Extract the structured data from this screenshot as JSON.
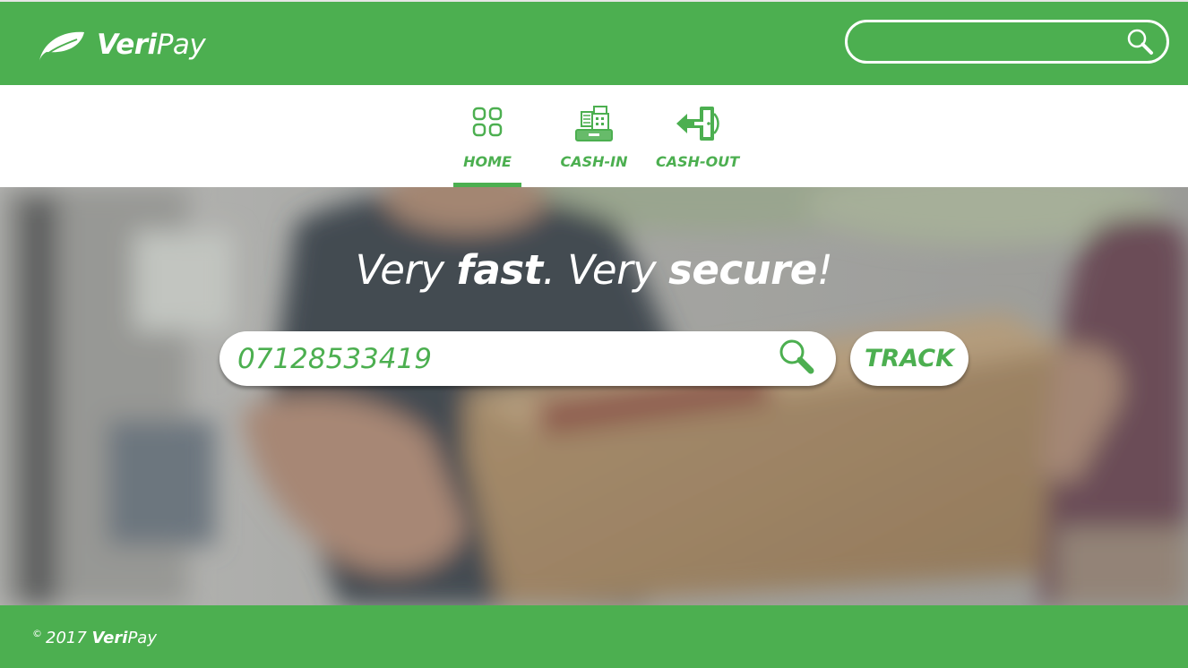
{
  "colors": {
    "brand_green": "#4caf50",
    "white": "#ffffff"
  },
  "header": {
    "brand_bold": "Veri",
    "brand_light": "Pay",
    "logo_icon": "leaf-icon",
    "search": {
      "value": "",
      "icon": "search-icon"
    }
  },
  "nav": {
    "items": [
      {
        "label": "HOME",
        "icon": "grid-icon",
        "active": true
      },
      {
        "label": "CASH-IN",
        "icon": "cash-register-icon",
        "active": false
      },
      {
        "label": "CASH-OUT",
        "icon": "exit-door-icon",
        "active": false
      }
    ]
  },
  "hero": {
    "tagline": {
      "part1": "Very ",
      "part2": "fast",
      "part3": ". Very ",
      "part4": "secure",
      "part5": "!"
    },
    "track_input": {
      "value": "07128533419",
      "icon": "search-icon"
    },
    "track_button": "TRACK"
  },
  "footer": {
    "copyright_symbol": "©",
    "year": "2017",
    "brand_bold": "Veri",
    "brand_light": "Pay"
  }
}
